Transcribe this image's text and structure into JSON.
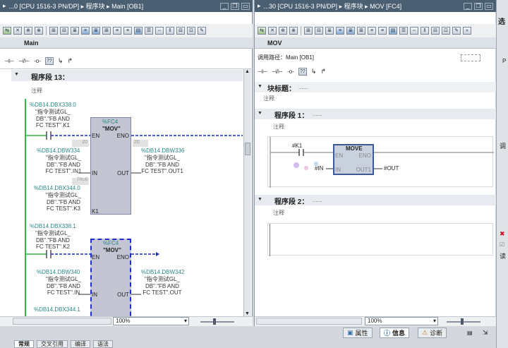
{
  "left_editor": {
    "title": "...0 [CPU 1516-3 PN/DP] ▸ 程序块 ▸ Main [OB1]",
    "block_name": "Main",
    "network": {
      "title": "程序段 13：",
      "comment": "注释",
      "rung1": {
        "contact_tag": "%DB14.DBX338.0",
        "contact_comment": [
          "\"指令测试GL_",
          "DB\".\"FB AND",
          "FC TEST\".K1"
        ],
        "block_ref": "%FC4",
        "block_name": "\"MOV\"",
        "en": "EN",
        "eno": "ENO",
        "in_default": "20",
        "in_tag": "%DB14.DBW334",
        "in_comment": [
          "\"指令测试GL_",
          "DB\".\"FB AND",
          "FC TEST\".IN1"
        ],
        "in_pin": "IN",
        "out_default": "20",
        "out_tag": "%DB14.DBW336",
        "out_comment": [
          "\"指令测试GL_",
          "DB\".\"FB AND",
          "FC TEST\".OUT1"
        ],
        "out_pin": "OUT",
        "k_default": "TRUE",
        "k_tag": "%DB14.DBX344.0",
        "k_comment": [
          "\"指令测试GL_",
          "DB\".\"FB AND",
          "FC TEST\".K3"
        ],
        "k_pin": "K1"
      },
      "rung2": {
        "contact_tag": "%DB14.DBX338.1",
        "contact_comment": [
          "\"指令测试GL_",
          "DB\".\"FB AND",
          "FC TEST\".K2"
        ],
        "block_ref": "%FC4",
        "block_name": "\"MOV\"",
        "en": "EN",
        "eno": "ENO",
        "in_tag": "%DB14.DBW340",
        "in_comment": [
          "\"指令测试GL_",
          "DB\".\"FB AND",
          "FC TEST\".IN"
        ],
        "in_pin": "IN",
        "out_tag": "%DB14.DBW342",
        "out_comment": [
          "\"指令测试GL_",
          "DB\".\"FB AND",
          "FC TEST\".OUT"
        ],
        "out_pin": "OUT",
        "k_tag": "%DB14.DBX344.1"
      }
    },
    "zoom": "100%"
  },
  "right_editor": {
    "title": "...30 [CPU 1516-3 PN/DP] ▸ 程序块 ▸ MOV [FC4]",
    "block_name": "MOV",
    "call_path": "调用路径：Main [OB1]",
    "block_title": "块标题：",
    "block_title_placeholder": "......",
    "block_comment": "注释",
    "network1": {
      "title": "程序段 1：",
      "placeholder": "......",
      "comment": "注释",
      "contact_tag": "#K1",
      "box_name": "MOVE",
      "en": "EN",
      "eno": "ENO",
      "in_tag": "#IN",
      "in_pin": "IN",
      "out_pin": "OUT1",
      "out_tag": "#OUT"
    },
    "network2": {
      "title": "程序段 2：",
      "placeholder": "......",
      "comment": "注释"
    },
    "zoom": "100%"
  },
  "side_panel": {
    "title": "选",
    "label_p": "P",
    "label_t": "调",
    "label_r": "读"
  },
  "inspector": {
    "tabs": [
      {
        "label": "属性",
        "icon": "properties-icon"
      },
      {
        "label": "信息",
        "icon": "info-icon"
      },
      {
        "label": "诊断",
        "icon": "diagnostics-icon"
      }
    ],
    "subtabs": [
      "常规",
      "交叉引用",
      "编译",
      "语法"
    ]
  },
  "colors": {
    "title_bar": "#4a5f72",
    "tag": "#2b8a88",
    "power_rail": "#33b54a",
    "selection": "#1e2dc9"
  }
}
